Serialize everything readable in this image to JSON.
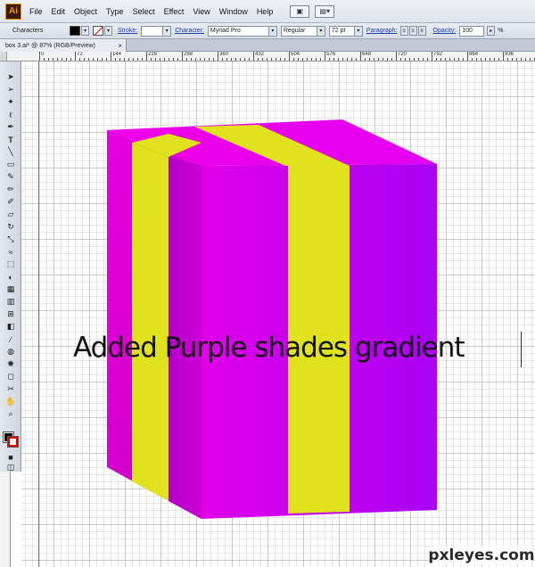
{
  "app": {
    "logo": "Ai",
    "menu": [
      "File",
      "Edit",
      "Object",
      "Type",
      "Select",
      "Effect",
      "View",
      "Window",
      "Help"
    ]
  },
  "control_bar": {
    "section": "Characters",
    "stroke_label": "Stroke:",
    "character_label": "Character:",
    "font_family": "Myriad Pro",
    "font_style": "Regular",
    "font_size": "72 pt",
    "paragraph_label": "Paragraph:",
    "opacity_label": "Opacity:",
    "opacity_value": "100",
    "percent": "%"
  },
  "document": {
    "tab_title": "box 3.ai* @ 87% (RGB/Preview)",
    "close": "×"
  },
  "ruler": {
    "labels": [
      "0",
      "72",
      "144",
      "216",
      "288",
      "360",
      "432",
      "504",
      "576",
      "648",
      "720",
      "792",
      "864",
      "936"
    ]
  },
  "canvas": {
    "caption": "Added Purple shades gradient",
    "colors": {
      "magenta": "#ee00e6",
      "purple": "#b000f0",
      "yellow": "#dfe21c"
    }
  },
  "watermark": "pxleyes.com",
  "icons": [
    "app-logo",
    "screen-mode-icon",
    "arrange-icon",
    "dropdown-arrow-icon",
    "align-left-icon",
    "align-center-icon",
    "align-right-icon"
  ]
}
